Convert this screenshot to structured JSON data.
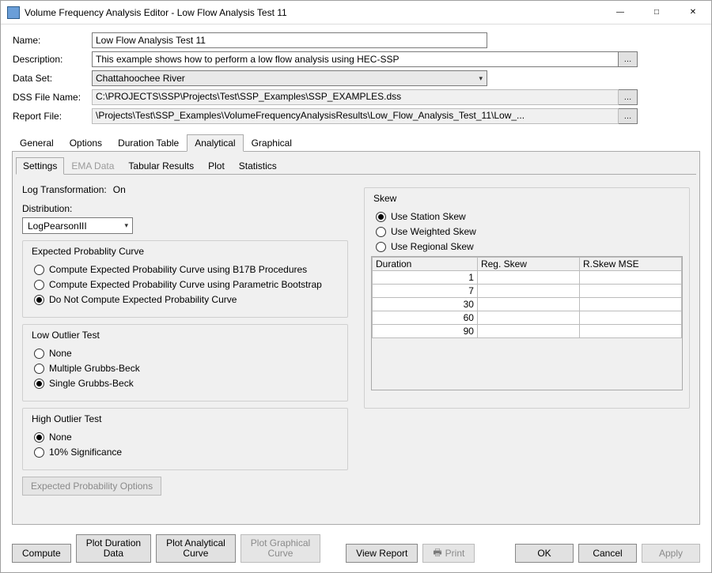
{
  "window": {
    "title": "Volume Frequency Analysis Editor - Low Flow Analysis Test 11"
  },
  "form": {
    "name_label": "Name:",
    "name_value": "Low Flow Analysis Test 11",
    "desc_label": "Description:",
    "desc_value": "This example shows how to perform a low flow analysis using HEC-SSP",
    "dataset_label": "Data Set:",
    "dataset_value": "Chattahoochee River",
    "dss_label": "DSS File Name:",
    "dss_value": "C:\\PROJECTS\\SSP\\Projects\\Test\\SSP_Examples\\SSP_EXAMPLES.dss",
    "report_label": "Report File:",
    "report_value": "\\Projects\\Test\\SSP_Examples\\VolumeFrequencyAnalysisResults\\Low_Flow_Analysis_Test_11\\Low_..."
  },
  "tabs": {
    "general": "General",
    "options": "Options",
    "duration": "Duration Table",
    "analytical": "Analytical",
    "graphical": "Graphical"
  },
  "subtabs": {
    "settings": "Settings",
    "ema": "EMA Data",
    "tabular": "Tabular Results",
    "plot": "Plot",
    "stats": "Statistics"
  },
  "settings": {
    "log_label": "Log Transformation:",
    "log_value": "On",
    "dist_label": "Distribution:",
    "dist_value": "LogPearsonIII",
    "epc": {
      "title": "Expected Probablity Curve",
      "opt1": "Compute Expected Probability Curve using B17B Procedures",
      "opt2": "Compute Expected Probability Curve using Parametric Bootstrap",
      "opt3": "Do Not Compute Expected Probability Curve"
    },
    "low": {
      "title": "Low Outlier Test",
      "opt1": "None",
      "opt2": "Multiple Grubbs-Beck",
      "opt3": "Single Grubbs-Beck"
    },
    "high": {
      "title": "High Outlier Test",
      "opt1": "None",
      "opt2": "10% Significance"
    },
    "exp_opts_btn": "Expected Probability Options"
  },
  "skew": {
    "title": "Skew",
    "opt1": "Use Station Skew",
    "opt2": "Use Weighted Skew",
    "opt3": "Use Regional Skew",
    "headers": {
      "dur": "Duration",
      "reg": "Reg. Skew",
      "mse": "R.Skew MSE"
    },
    "rows": [
      "1",
      "7",
      "30",
      "60",
      "90"
    ]
  },
  "buttons": {
    "compute": "Compute",
    "plot_dur1": "Plot Duration",
    "plot_dur2": "Data",
    "plot_an1": "Plot Analytical",
    "plot_an2": "Curve",
    "plot_gr1": "Plot Graphical",
    "plot_gr2": "Curve",
    "view_report": "View Report",
    "print": "Print",
    "ok": "OK",
    "cancel": "Cancel",
    "apply": "Apply"
  }
}
